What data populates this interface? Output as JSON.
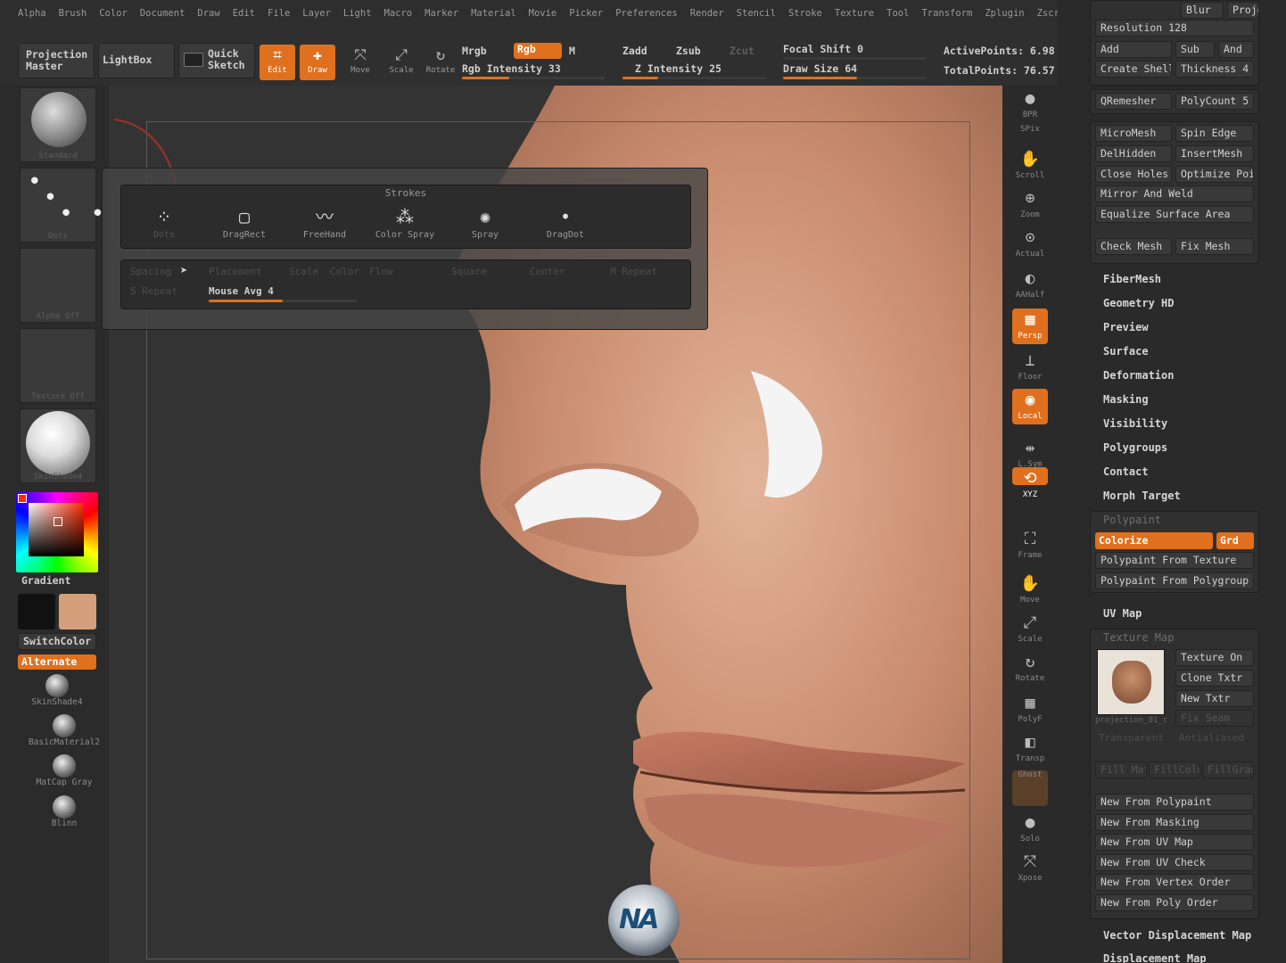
{
  "menu": [
    "Alpha",
    "Brush",
    "Color",
    "Document",
    "Draw",
    "Edit",
    "File",
    "Layer",
    "Light",
    "Macro",
    "Marker",
    "Material",
    "Movie",
    "Picker",
    "Preferences",
    "Render",
    "Stencil",
    "Stroke",
    "Texture",
    "Tool",
    "Transform",
    "Zplugin",
    "Zscript"
  ],
  "shelf": {
    "projection_master": "Projection Master",
    "lightbox": "LightBox",
    "quick_sketch": "Quick Sketch",
    "tools": [
      {
        "label": "Edit",
        "on": true
      },
      {
        "label": "Draw",
        "on": true
      },
      {
        "label": "Move",
        "on": false
      },
      {
        "label": "Scale",
        "on": false
      },
      {
        "label": "Rotate",
        "on": false
      }
    ],
    "mrgb": "Mrgb",
    "rgb": "Rgb",
    "m": "M",
    "rgb_intensity": "Rgb Intensity 33",
    "zadd": "Zadd",
    "zsub": "Zsub",
    "zcut": "Zcut",
    "z_intensity": "Z Intensity 25",
    "focal_shift": "Focal Shift 0",
    "draw_size": "Draw Size 64",
    "active_points": "ActivePoints: 6.98",
    "total_points": "TotalPoints: 76.57"
  },
  "left": {
    "brush_caption": "Standard",
    "stroke_caption": "Dots",
    "alpha_caption": "Alpha Off",
    "texture_caption": "Texture Off",
    "material_caption": "SkinShade4",
    "gradient": "Gradient",
    "switch_color": "SwitchColor",
    "alternate": "Alternate",
    "materials": [
      "SkinShade4",
      "BasicMaterial2",
      "MatCap Gray",
      "Blinn"
    ],
    "secondary_color": "#d4a07c"
  },
  "strokes_popup": {
    "title": "Strokes",
    "items": [
      "Dots",
      "DragRect",
      "FreeHand",
      "Color Spray",
      "Spray",
      "DragDot"
    ],
    "row1": [
      "Spacing",
      "Placement",
      "Scale",
      "Color",
      "Flow",
      "Square",
      "Center",
      "M Repeat"
    ],
    "row2": [
      "S Repeat",
      "Mouse Avg 4"
    ]
  },
  "right_dock": [
    "BPR",
    "SPix",
    "Scroll",
    "Zoom",
    "Actual",
    "AAHalf",
    "Persp",
    "Floor",
    "Local",
    "L.Sym",
    "XYZ",
    "Frame",
    "Move",
    "Scale",
    "Rotate",
    "PolyF",
    "Transp",
    "Ghost",
    "Solo",
    "Xpose"
  ],
  "rpanel": {
    "blur": "Blur",
    "projec": "Projec",
    "resolution": "Resolution 128",
    "add": "Add",
    "sub": "Sub",
    "and": "And",
    "create_shell": "Create Shell",
    "thickness": "Thickness 4",
    "qremesher": "QRemesher",
    "polycount": "PolyCount 5",
    "micromesh": "MicroMesh",
    "spin_edge": "Spin Edge",
    "delhidden": "DelHidden",
    "insertmesh": "InsertMesh",
    "close_holes": "Close Holes",
    "optimize": "Optimize Poi",
    "mirror_weld": "Mirror And Weld",
    "equalize": "Equalize Surface Area",
    "check_mesh": "Check Mesh",
    "fix_mesh": "Fix Mesh",
    "sections": [
      "FiberMesh",
      "Geometry HD",
      "Preview",
      "Surface",
      "Deformation",
      "Masking",
      "Visibility",
      "Polygroups",
      "Contact",
      "Morph Target"
    ],
    "polypaint": "Polypaint",
    "colorize": "Colorize",
    "grd": "Grd",
    "pp_texture": "Polypaint From Texture",
    "pp_polygroup": "Polypaint From Polygroup",
    "uv_map": "UV Map",
    "texture_map": "Texture Map",
    "texture_on": "Texture On",
    "clone_txtr": "Clone Txtr",
    "new_txtr": "New Txtr",
    "fix_seam": "Fix Seam",
    "thumb_caption": "projection_01_c",
    "transparent": "Transparent",
    "antialiased": "Antialiased",
    "fill_mat": "Fill Mat",
    "fillcolor": "FillColor",
    "fillgrad": "FillGrad",
    "new_from": [
      "New From Polypaint",
      "New From Masking",
      "New From UV Map",
      "New From UV Check",
      "New From Vertex Order",
      "New From Poly Order"
    ],
    "vector_disp": "Vector Displacement Map",
    "disp_map": "Displacement Map"
  }
}
